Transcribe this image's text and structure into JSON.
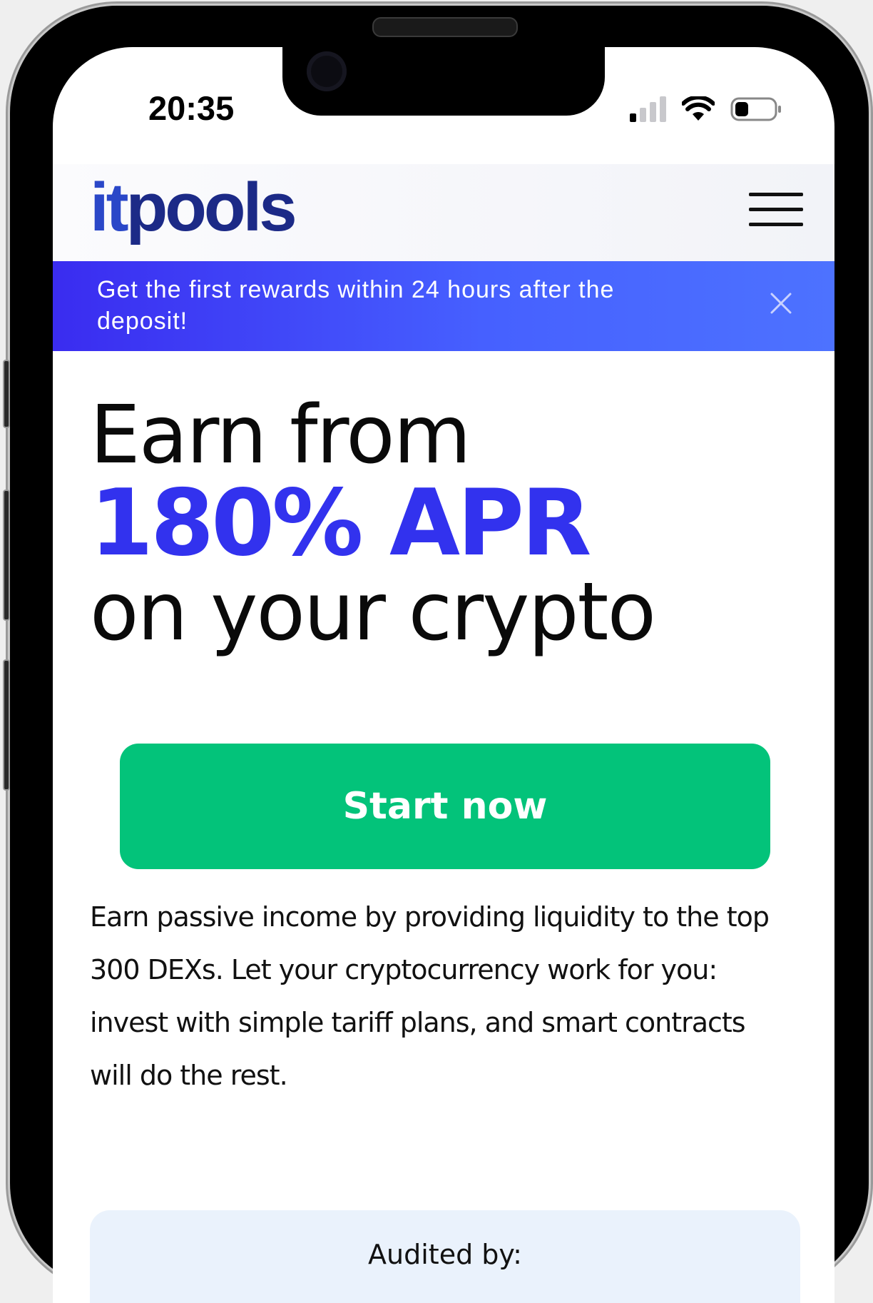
{
  "status_bar": {
    "time": "20:35",
    "icons": [
      "cellular-signal-icon",
      "wifi-icon",
      "battery-icon"
    ]
  },
  "header": {
    "logo_prefix": "it",
    "logo_suffix": "pools",
    "menu_icon": "hamburger-menu-icon"
  },
  "banner": {
    "text": "Get the first rewards within 24 hours after the deposit!",
    "close_icon": "close-icon"
  },
  "hero": {
    "line1": "Earn from",
    "line2": "180% APR",
    "line3": "on your crypto"
  },
  "cta": {
    "label": "Start now"
  },
  "description": "Earn passive income by providing liquidity to the top 300 DEXs. Let your cryptocurrency work for you: invest with simple tariff plans, and smart contracts will do the rest.",
  "audit": {
    "title": "Audited by:"
  },
  "colors": {
    "accent_blue": "#3232ee",
    "banner_blue": "#4660ff",
    "cta_green": "#03c37a",
    "audit_bg": "#eaf2fc"
  }
}
